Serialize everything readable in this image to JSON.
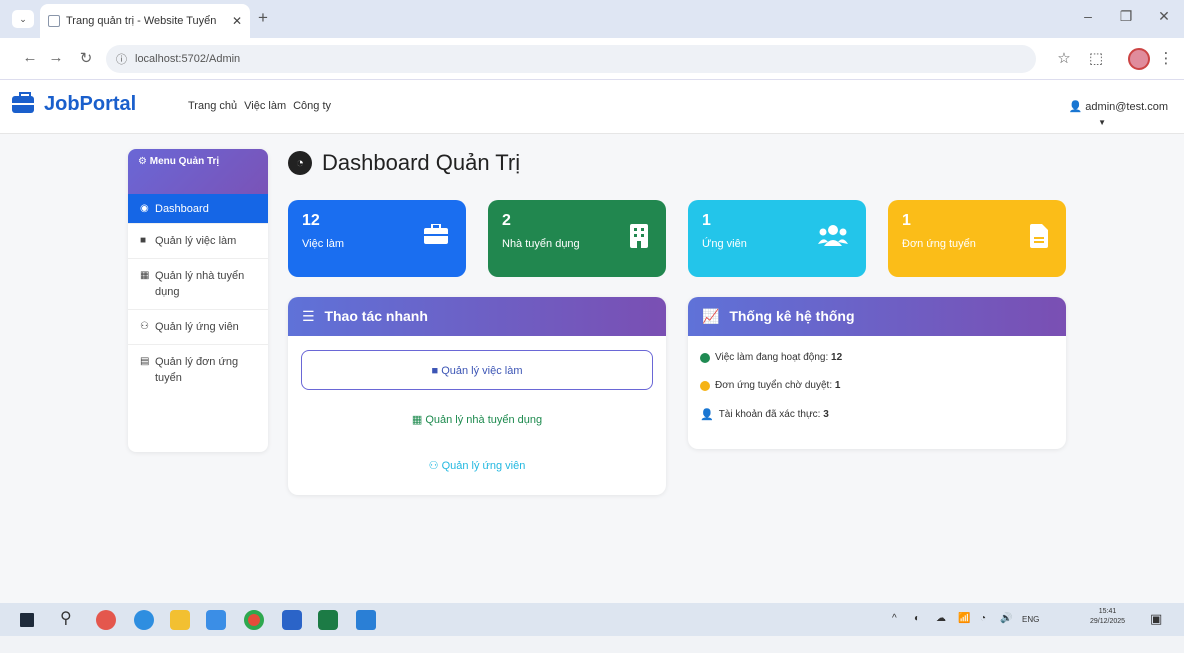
{
  "browser": {
    "tab_title": "Trang quản trị - Website Tuyển",
    "url": "localhost:5702/Admin"
  },
  "navbar": {
    "brand": "JobPortal",
    "links": [
      "Trang chủ",
      "Việc làm",
      "Công ty"
    ],
    "user": "admin@test.com"
  },
  "sidebar": {
    "header": "Menu Quản Trị",
    "items": [
      {
        "label": "Dashboard",
        "icon": "gauge-icon"
      },
      {
        "label": "Quản lý việc làm",
        "icon": "briefcase-icon"
      },
      {
        "label": "Quản lý nhà tuyển dụng",
        "icon": "building-icon"
      },
      {
        "label": "Quản lý ứng viên",
        "icon": "users-icon"
      },
      {
        "label": "Quản lý đơn ứng tuyển",
        "icon": "file-icon"
      }
    ]
  },
  "page": {
    "title": "Dashboard Quản Trị"
  },
  "cards": [
    {
      "value": "12",
      "label": "Việc làm",
      "color": "#1a6ef0",
      "icon": "briefcase-icon"
    },
    {
      "value": "2",
      "label": "Nhà tuyển dụng",
      "color": "#21874f",
      "icon": "building-icon"
    },
    {
      "value": "1",
      "label": "Ứng viên",
      "color": "#23c5ea",
      "icon": "users-icon"
    },
    {
      "value": "1",
      "label": "Đơn ứng tuyển",
      "color": "#fbbd18",
      "icon": "file-icon"
    }
  ],
  "quick_actions": {
    "title": "Thao tác nhanh",
    "items": [
      {
        "label": "Quản lý việc làm",
        "color": "#3c55b5"
      },
      {
        "label": "Quản lý nhà tuyển dụng",
        "color": "#1d8a4e"
      },
      {
        "label": "Quản lý ứng viên",
        "color": "#22b8e0"
      }
    ]
  },
  "stats": {
    "title": "Thống kê hệ thống",
    "items": [
      {
        "label": "Việc làm đang hoạt động:",
        "value": "12",
        "color": "#1f8a52"
      },
      {
        "label": "Đơn ứng tuyển chờ duyệt:",
        "value": "1",
        "color": "#f5b316"
      },
      {
        "label": "Tài khoản đã xác thực:",
        "value": "3",
        "color": "#23b7e6"
      }
    ]
  },
  "taskbar": {
    "time": "15:41",
    "date": "29/12/2025",
    "lang": "ENG"
  }
}
